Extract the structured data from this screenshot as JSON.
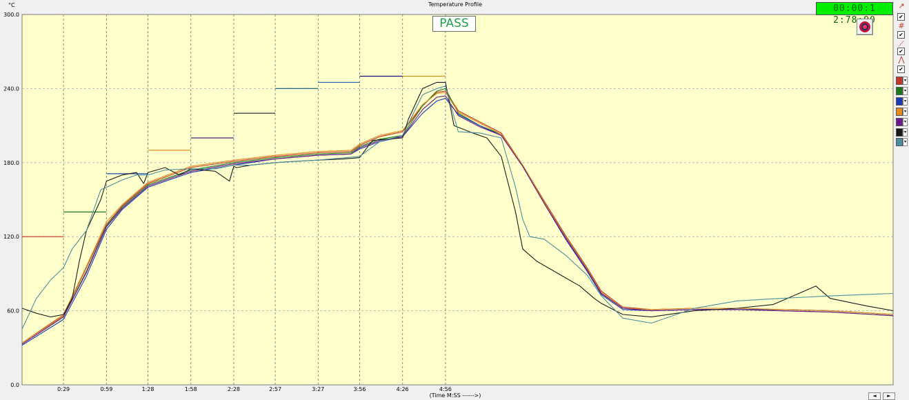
{
  "header": {
    "title": "Temperature Profile",
    "unit": "°C",
    "timer": "00:00:1 2:78:90",
    "status": "PASS"
  },
  "colors": {
    "plot_bg": "#ffffcc",
    "grid": "#b5b5b5",
    "pass_text": "#1aa047"
  },
  "toolbar": {
    "icons": [
      "cursor-icon",
      "grid-icon",
      "line-tool-icon",
      "peak-icon"
    ],
    "checks": [
      "✔",
      "✔",
      "✔",
      "✔"
    ]
  },
  "nav": {
    "prev": "◄",
    "next": "►"
  },
  "chart_data": {
    "type": "line",
    "title": "Temperature Profile",
    "xlabel": "(Time M:SS ------>)",
    "ylabel": "°C",
    "ylim": [
      0,
      300
    ],
    "xlim_seconds": [
      0,
      609
    ],
    "grid": true,
    "y_ticks": [
      "300.0",
      "240.0",
      "180.0",
      "120.0",
      "60.0",
      "0.0"
    ],
    "x_ticks": [
      "0:29",
      "0:59",
      "1:28",
      "1:58",
      "2:28",
      "2:57",
      "3:27",
      "3:56",
      "4:26",
      "4:56"
    ],
    "x_tick_seconds": [
      29,
      59,
      88,
      118,
      148,
      177,
      207,
      236,
      266,
      296
    ],
    "zone_setpoints": [
      {
        "start": 0,
        "end": 29,
        "value": 120,
        "color": "#c03020"
      },
      {
        "start": 29,
        "end": 59,
        "value": 140,
        "color": "#1a7a1a"
      },
      {
        "start": 59,
        "end": 88,
        "value": 171,
        "color": "#1a4ab0"
      },
      {
        "start": 88,
        "end": 118,
        "value": 190,
        "color": "#e09020"
      },
      {
        "start": 118,
        "end": 148,
        "value": 200,
        "color": "#4a1a7a"
      },
      {
        "start": 148,
        "end": 177,
        "value": 220,
        "color": "#1a1a2a"
      },
      {
        "start": 177,
        "end": 207,
        "value": 240,
        "color": "#1a6a8a"
      },
      {
        "start": 207,
        "end": 236,
        "value": 245,
        "color": "#2060b0"
      },
      {
        "start": 236,
        "end": 266,
        "value": 250,
        "color": "#101080"
      },
      {
        "start": 266,
        "end": 296,
        "value": 250,
        "color": "#d09010"
      }
    ],
    "series": [
      {
        "color": "#c0392b",
        "x": [
          0,
          29,
          45,
          59,
          70,
          88,
          118,
          148,
          177,
          207,
          230,
          236,
          250,
          266,
          280,
          290,
          296,
          305,
          320,
          335,
          350,
          365,
          380,
          395,
          405,
          420,
          440,
          470,
          500,
          530,
          565,
          609
        ],
        "values": [
          34,
          56,
          95,
          130,
          145,
          163,
          176,
          181,
          185,
          188,
          189,
          194,
          201,
          205,
          226,
          237,
          238,
          222,
          213,
          204,
          178,
          149,
          121,
          95,
          76,
          63,
          61,
          62,
          62,
          61,
          60,
          57
        ]
      },
      {
        "color": "#1a7a1a",
        "x": [
          0,
          29,
          45,
          59,
          70,
          88,
          118,
          148,
          177,
          207,
          230,
          236,
          250,
          266,
          280,
          290,
          296,
          305,
          320,
          335,
          350,
          365,
          380,
          395,
          405,
          420,
          440,
          470,
          500,
          530,
          565,
          609
        ],
        "values": [
          33,
          55,
          92,
          129,
          144,
          162,
          174,
          180,
          184,
          187,
          188,
          193,
          199,
          202,
          226,
          238,
          240,
          220,
          210,
          203,
          178,
          148,
          120,
          94,
          74,
          62,
          60,
          61,
          61,
          60,
          59,
          56
        ]
      },
      {
        "color": "#1a3ab8",
        "x": [
          0,
          29,
          45,
          59,
          70,
          88,
          118,
          148,
          177,
          207,
          230,
          236,
          250,
          266,
          280,
          290,
          296,
          305,
          320,
          335,
          350,
          365,
          380,
          395,
          405,
          420,
          440,
          470,
          500,
          530,
          565,
          609
        ],
        "values": [
          32,
          53,
          88,
          126,
          142,
          160,
          172,
          178,
          183,
          186,
          187,
          191,
          197,
          201,
          220,
          230,
          232,
          219,
          210,
          202,
          177,
          147,
          118,
          92,
          73,
          61,
          60,
          61,
          61,
          61,
          60,
          57
        ]
      },
      {
        "color": "#e08a20",
        "x": [
          0,
          29,
          45,
          59,
          70,
          88,
          118,
          148,
          177,
          207,
          230,
          236,
          250,
          266,
          280,
          290,
          296,
          305,
          320,
          335,
          350,
          365,
          380,
          395,
          405,
          420,
          440,
          470,
          500,
          530,
          565,
          609
        ],
        "values": [
          34,
          57,
          96,
          132,
          146,
          164,
          177,
          182,
          186,
          189,
          190,
          195,
          202,
          206,
          227,
          236,
          237,
          221,
          212,
          203,
          178,
          148,
          120,
          94,
          75,
          62,
          61,
          62,
          62,
          61,
          60,
          57
        ]
      },
      {
        "color": "#6a1a8a",
        "x": [
          0,
          29,
          45,
          59,
          70,
          88,
          118,
          148,
          177,
          207,
          230,
          236,
          250,
          266,
          280,
          290,
          296,
          305,
          320,
          335,
          350,
          365,
          380,
          395,
          405,
          420,
          440,
          470,
          500,
          530,
          565,
          609
        ],
        "values": [
          33,
          55,
          91,
          128,
          143,
          161,
          173,
          179,
          183,
          186,
          187,
          192,
          198,
          201,
          223,
          233,
          234,
          218,
          209,
          202,
          177,
          147,
          119,
          93,
          74,
          62,
          60,
          61,
          61,
          60,
          59,
          56
        ]
      },
      {
        "color": "#1a1a1a",
        "x": [
          0,
          10,
          20,
          29,
          35,
          40,
          45,
          55,
          59,
          70,
          80,
          85,
          88,
          100,
          110,
          115,
          118,
          135,
          145,
          148,
          150,
          160,
          177,
          190,
          207,
          225,
          236,
          245,
          266,
          270,
          280,
          290,
          296,
          302,
          315,
          325,
          335,
          345,
          350,
          360,
          375,
          390,
          400,
          405,
          420,
          440,
          470,
          500,
          525,
          535,
          545,
          555,
          565,
          590,
          609
        ],
        "values": [
          62,
          58,
          55,
          57,
          70,
          100,
          125,
          150,
          165,
          170,
          172,
          163,
          172,
          176,
          170,
          173,
          175,
          173,
          165,
          177,
          176,
          178,
          180,
          181,
          182,
          183,
          184,
          198,
          200,
          215,
          240,
          245,
          245,
          210,
          204,
          200,
          185,
          140,
          110,
          100,
          90,
          80,
          70,
          66,
          57,
          55,
          60,
          62,
          65,
          70,
          75,
          80,
          70,
          64,
          60
        ]
      },
      {
        "color": "#4a8ea0",
        "x": [
          0,
          10,
          20,
          29,
          35,
          45,
          55,
          59,
          70,
          80,
          88,
          100,
          118,
          135,
          148,
          160,
          177,
          207,
          236,
          250,
          266,
          280,
          290,
          296,
          305,
          320,
          335,
          345,
          350,
          355,
          365,
          380,
          395,
          405,
          420,
          440,
          470,
          500,
          530,
          565,
          609
        ],
        "values": [
          45,
          70,
          85,
          95,
          110,
          125,
          158,
          160,
          166,
          170,
          170,
          174,
          175,
          175,
          178,
          178,
          180,
          182,
          185,
          197,
          202,
          235,
          240,
          242,
          205,
          204,
          200,
          160,
          134,
          120,
          118,
          105,
          89,
          72,
          54,
          50,
          62,
          68,
          70,
          72,
          74
        ]
      }
    ]
  }
}
